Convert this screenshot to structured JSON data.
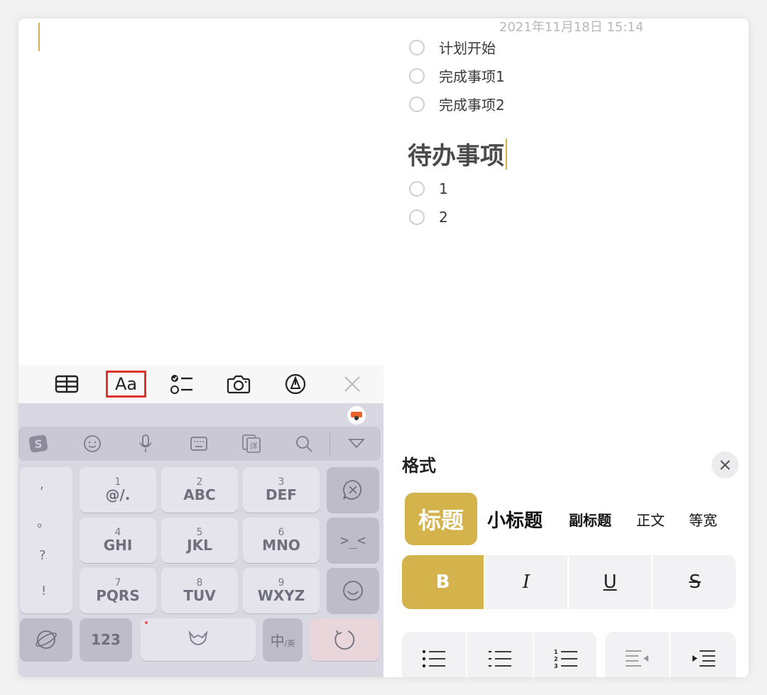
{
  "note": {
    "date": "2021年11月18日 15:14",
    "checklist_top": [
      "计划开始",
      "完成事项1",
      "完成事项2"
    ],
    "heading": "待办事项",
    "checklist_bottom": [
      "1",
      "2"
    ]
  },
  "toolbar": {
    "items": [
      "table-icon",
      "Aa",
      "checklist-icon",
      "camera-icon",
      "markup-icon",
      "close-icon"
    ],
    "format_label": "Aa"
  },
  "keyboard": {
    "keys": [
      {
        "num": "1",
        "let": "@/."
      },
      {
        "num": "2",
        "let": "ABC"
      },
      {
        "num": "3",
        "let": "DEF"
      },
      {
        "num": "4",
        "let": "GHI"
      },
      {
        "num": "5",
        "let": "JKL"
      },
      {
        "num": "6",
        "let": "MNO"
      },
      {
        "num": "7",
        "let": "PQRS"
      },
      {
        "num": "8",
        "let": "TUV"
      },
      {
        "num": "9",
        "let": "WXYZ"
      }
    ],
    "side_punctuation": [
      ",",
      "。",
      "?",
      "!"
    ],
    "key_123": "123",
    "key_lang_main": "中",
    "key_lang_sub": "/英",
    "emoji_key": ">_<",
    "accent_color": "#d4b24c"
  },
  "format_panel": {
    "title": "格式",
    "styles": [
      "标题",
      "小标题",
      "副标题",
      "正文",
      "等宽"
    ],
    "text_styles": [
      "B",
      "I",
      "U",
      "S"
    ]
  }
}
